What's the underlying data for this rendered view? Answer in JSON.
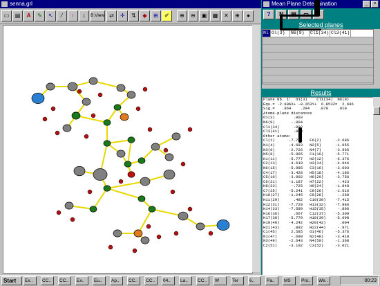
{
  "left_window": {
    "title": "senna.grl",
    "toolbar": {
      "view_label": "B.View",
      "tools": [
        "tool-1",
        "tool-2",
        "tool-3",
        "tool-4",
        "tool-5",
        "tool-6",
        "tool-7"
      ]
    }
  },
  "right_window": {
    "title": "Mean Plane Determination",
    "tools": {
      "help": "?",
      "mode": "N",
      "calc": "",
      "copy": "",
      "close": "X"
    },
    "selected_planes": {
      "header": "Selected planes",
      "rows": [
        {
          "n": "Nl",
          "a": "Ol(3)",
          "b": "N6(9)",
          "c": "Cl1(34)",
          "d": "Cl3(41)"
        }
      ]
    },
    "results": {
      "header": "Results",
      "lines": [
        "Plane Nb. 1:  O1(3)    Cl1(34)  N6(9)",
        "",
        "Equ.= -2.906X+ -8.263Y+  6.853Z=  2.686",
        "Sig.=   .964    .294    .070    .010",
        "Atoms-plane distances",
        "O1(3)        .003",
        "N6(9)       -.004",
        "Cl1(34)      .002",
        "Cl3(41)      .003",
        "Other atoms:",
        "Cl(1)      -7.761   F6(2)      -2.686",
        "N1(4)      -4.683   N2(5)      -1.955",
        "N3(6)      -2.726   N4(7)      -3.965",
        "N5(8)      -5.965   C1(10)     -5.771",
        "H1(11)     -5.777   H2(12)     -6.376",
        "C2(13)     -4.619   H3(14)     -4.946",
        "N6(15)     -5.985   C3(16)     -3.603",
        "C4(17)     -3.428   H5(18)     -4.186",
        "C5(19)     -3.002   H6(20)     -3.756",
        "C6(21)     -1.187   H7(22)      -.423",
        "H8(23)      -.725   H9(24)     -1.848",
        "C7(25)     -5.241   C8(26)     -1.616",
        "H10(27)    -1.245   C9(28)      -.268",
        "H11(29)      .482   C10(30)    -7.415",
        "H12(31)    -7.720   H13(32)    -7.986",
        "H14(33)    -7.589   H15(35)     -.896",
        "H16(36)      .667   C12(37)    -5.309",
        "H17(38)    -5.779   H18(39)    -5.698",
        "H19(40)    -4.242   H20(42)      .004",
        "H21(43)      .892   H22(44)     -.971",
        "C1(45)      2.585   O1(46)     -5.376",
        "N1(47)      -.690   N2(48)     -3.418",
        "N3(49)     -2.643   N4(50)     -1.368",
        "C2(51)     -3.102   C3(52)     -3.021"
      ]
    }
  },
  "taskbar": {
    "start_label": "Start",
    "tasks": [
      "Ex..",
      "CC..",
      "CC..",
      "Ex..",
      "Eu..",
      "Ap..",
      "CC..",
      "CC..",
      "04..",
      "La..",
      "CC..",
      "W",
      "Ter",
      "6..",
      "Pa..",
      "MS",
      "Pro..",
      "We.."
    ],
    "clock": "00:23"
  },
  "colors": {
    "title": "#000080",
    "desktop": "#008080",
    "atom_green": "#1a7a1a",
    "atom_red": "#c01010",
    "atom_blue": "#2a7fd0",
    "atom_orange": "#e07a20",
    "bond": "#e8d800"
  }
}
